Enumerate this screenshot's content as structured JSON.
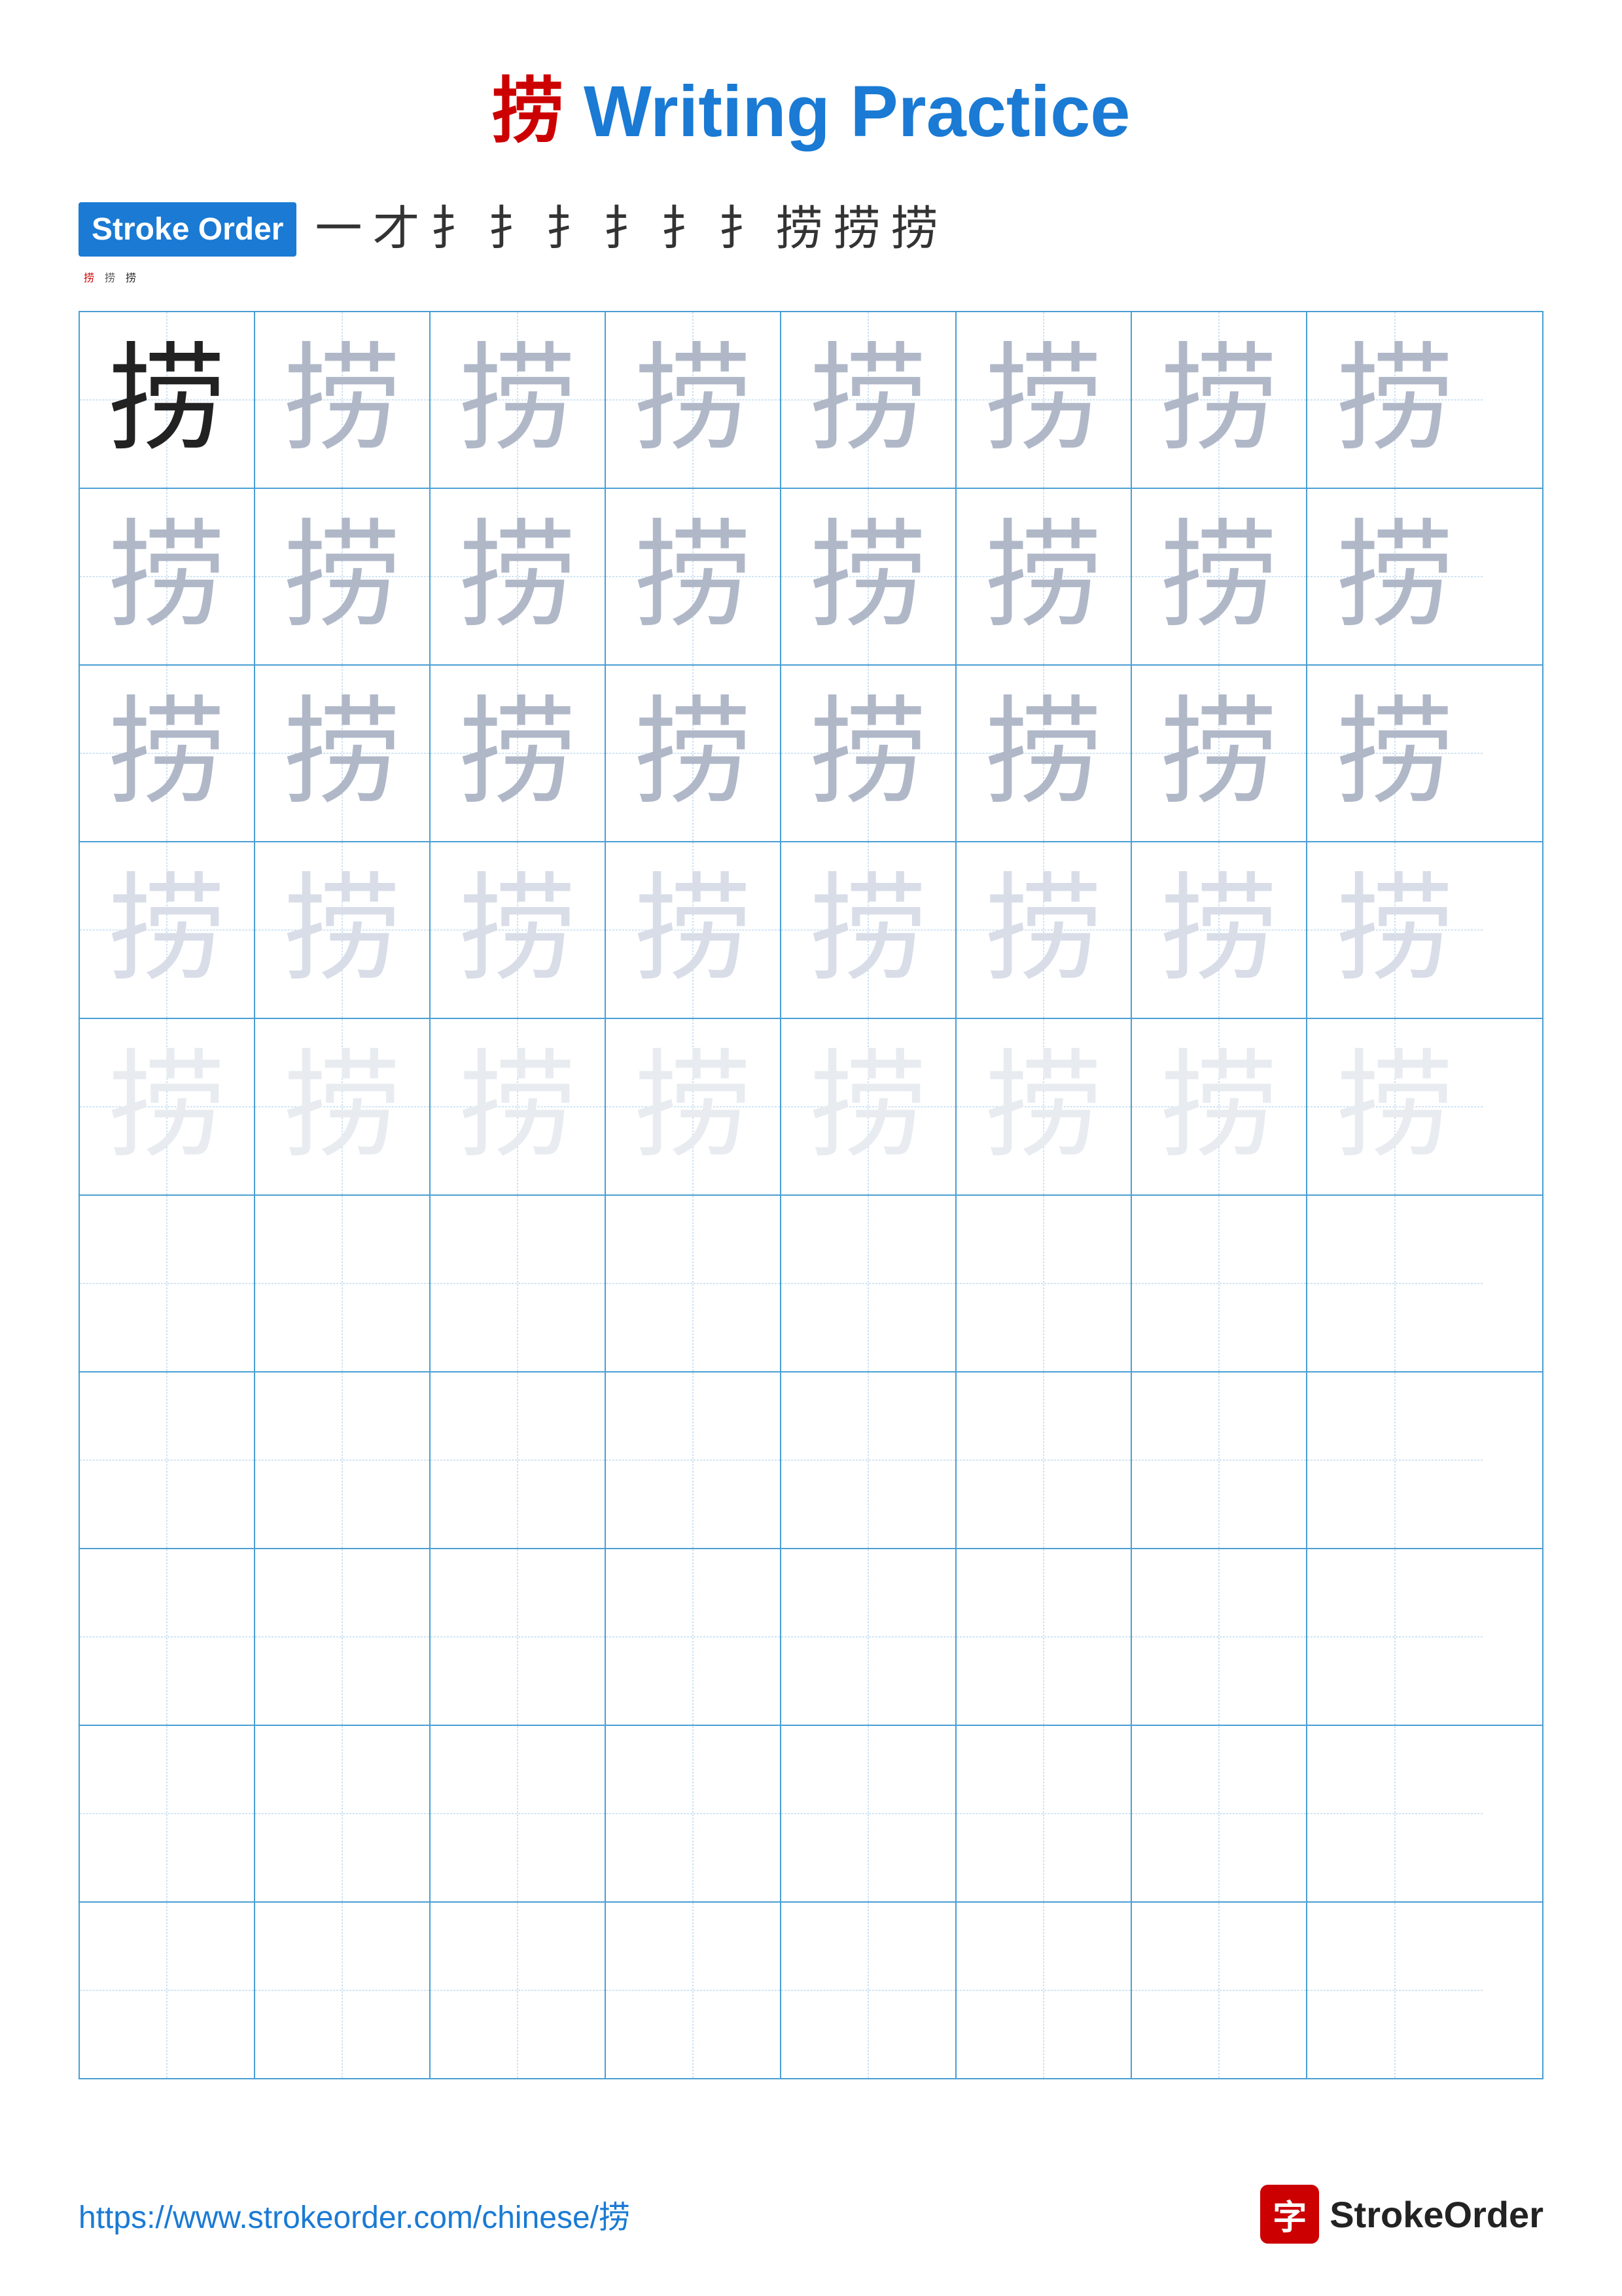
{
  "page": {
    "title_char": "捞",
    "title_text": " Writing Practice",
    "stroke_order_label": "Stroke Order",
    "stroke_chars_line1": [
      "一",
      "才",
      "扌",
      "扌",
      "扌",
      "扌",
      "扌",
      "扌",
      "扌",
      "捞",
      "捞"
    ],
    "stroke_chars_line2": [
      "捞",
      "捞",
      "捞"
    ],
    "practice_char": "捞",
    "footer_url": "https://www.strokeorder.com/chinese/捞",
    "footer_logo_icon": "字",
    "footer_logo_text": "StrokeOrder"
  },
  "grid": {
    "rows": 10,
    "cols": 8,
    "char_rows": [
      {
        "shade": "dark",
        "count": 8
      },
      {
        "shade": "medium",
        "count": 8
      },
      {
        "shade": "medium",
        "count": 8
      },
      {
        "shade": "light",
        "count": 8
      },
      {
        "shade": "very-light",
        "count": 8
      },
      {
        "shade": "empty",
        "count": 8
      },
      {
        "shade": "empty",
        "count": 8
      },
      {
        "shade": "empty",
        "count": 8
      },
      {
        "shade": "empty",
        "count": 8
      },
      {
        "shade": "empty",
        "count": 8
      }
    ]
  }
}
